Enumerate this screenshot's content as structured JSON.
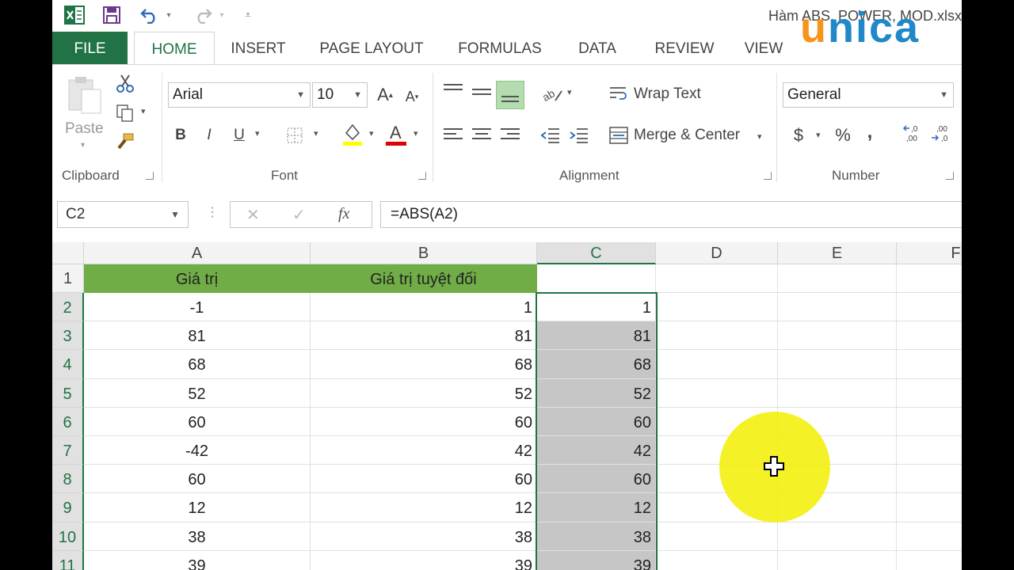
{
  "window": {
    "title": "Hàm ABS, POWER, MOD.xlsx",
    "watermark": "unica",
    "watermark_colors": {
      "u": "#f7941d",
      "nica": "#1e88c9"
    }
  },
  "tabs": [
    {
      "label": "FILE"
    },
    {
      "label": "HOME"
    },
    {
      "label": "INSERT"
    },
    {
      "label": "PAGE LAYOUT"
    },
    {
      "label": "FORMULAS"
    },
    {
      "label": "DATA"
    },
    {
      "label": "REVIEW"
    },
    {
      "label": "VIEW"
    }
  ],
  "ribbon": {
    "clipboard": {
      "paste_label": "Paste",
      "group_label": "Clipboard"
    },
    "font": {
      "font_name": "Arial",
      "font_size": "10",
      "group_label": "Font",
      "bold": "B",
      "italic": "I",
      "underline": "U",
      "grow": "A",
      "shrink": "A"
    },
    "alignment": {
      "wrap_text": "Wrap Text",
      "merge_center": "Merge & Center",
      "group_label": "Alignment"
    },
    "number": {
      "format": "General",
      "currency": "$",
      "percent": "%",
      "comma": ",",
      "group_label": "Number"
    }
  },
  "formula_bar": {
    "name_box": "C2",
    "formula": "=ABS(A2)",
    "fx_label": "fx"
  },
  "sheet": {
    "columns": [
      "A",
      "B",
      "C",
      "D",
      "E",
      "F"
    ],
    "selected_column": "C",
    "header_row": {
      "row": "1",
      "A": "Giá trị",
      "B": "Giá trị tuyệt đối",
      "C": ""
    },
    "rows": [
      {
        "row": "2",
        "A": "-1",
        "B": "1",
        "C": "1"
      },
      {
        "row": "3",
        "A": "81",
        "B": "81",
        "C": "81"
      },
      {
        "row": "4",
        "A": "68",
        "B": "68",
        "C": "68"
      },
      {
        "row": "5",
        "A": "52",
        "B": "52",
        "C": "52"
      },
      {
        "row": "6",
        "A": "60",
        "B": "60",
        "C": "60"
      },
      {
        "row": "7",
        "A": "-42",
        "B": "42",
        "C": "42"
      },
      {
        "row": "8",
        "A": "60",
        "B": "60",
        "C": "60"
      },
      {
        "row": "9",
        "A": "12",
        "B": "12",
        "C": "12"
      },
      {
        "row": "10",
        "A": "38",
        "B": "38",
        "C": "38"
      },
      {
        "row": "11",
        "A": "39",
        "B": "39",
        "C": "39"
      }
    ],
    "colors": {
      "header_fill": "#70ad47",
      "selection": "#217346",
      "selected_fill": "#c6c6c6"
    }
  }
}
